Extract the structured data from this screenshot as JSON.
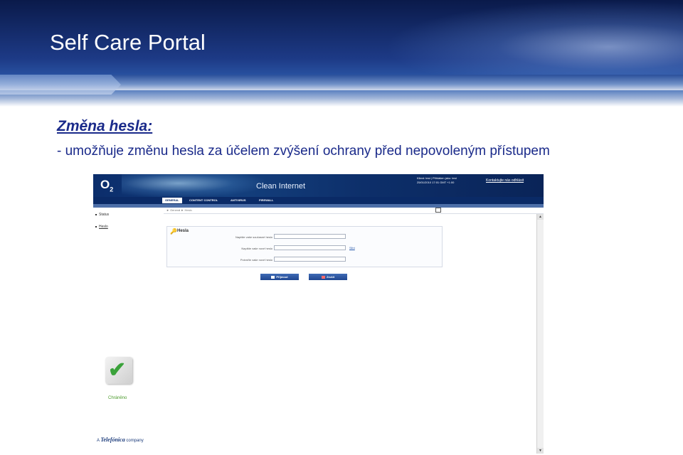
{
  "slide": {
    "title": "Self Care Portal",
    "heading": "Změna hesla:",
    "bullet": "- umožňuje změnu hesla za účelem zvýšení ochrany před nepovoleným přístupem"
  },
  "app": {
    "logo": "O",
    "logo_sub": "2",
    "name": "Clean Internet",
    "user_line1": "Klient: test  |  Přihlášen jako: test",
    "user_line2": "25/01/2010 17:01 GMT +1:00",
    "contact_link": "Kontaktujte nás  odhlásit",
    "tabs": [
      {
        "label": "GENERAL",
        "active": true
      },
      {
        "label": "CONTENT CONTROL",
        "active": false
      },
      {
        "label": "ANTIVIRUS",
        "active": false
      },
      {
        "label": "FIREWALL",
        "active": false
      }
    ],
    "nav": [
      {
        "label": "Status",
        "selected": false
      },
      {
        "label": "Heslo",
        "selected": true
      }
    ],
    "breadcrumb": "► General ► Heslo",
    "panel_title": "Hesla",
    "fields": [
      {
        "label": "Napište vaše současné heslo",
        "value": ""
      },
      {
        "label": "Napište vaše nové heslo",
        "value": "",
        "hint": "Silní"
      },
      {
        "label": "Potvrďte vaše nové heslo",
        "value": ""
      }
    ],
    "buttons": {
      "submit": "Přijmout",
      "cancel": "Zrušit"
    },
    "status_label": "Chráněno",
    "footer_prefix": "A",
    "footer_brand": "Telefónica",
    "footer_suffix": "company"
  }
}
